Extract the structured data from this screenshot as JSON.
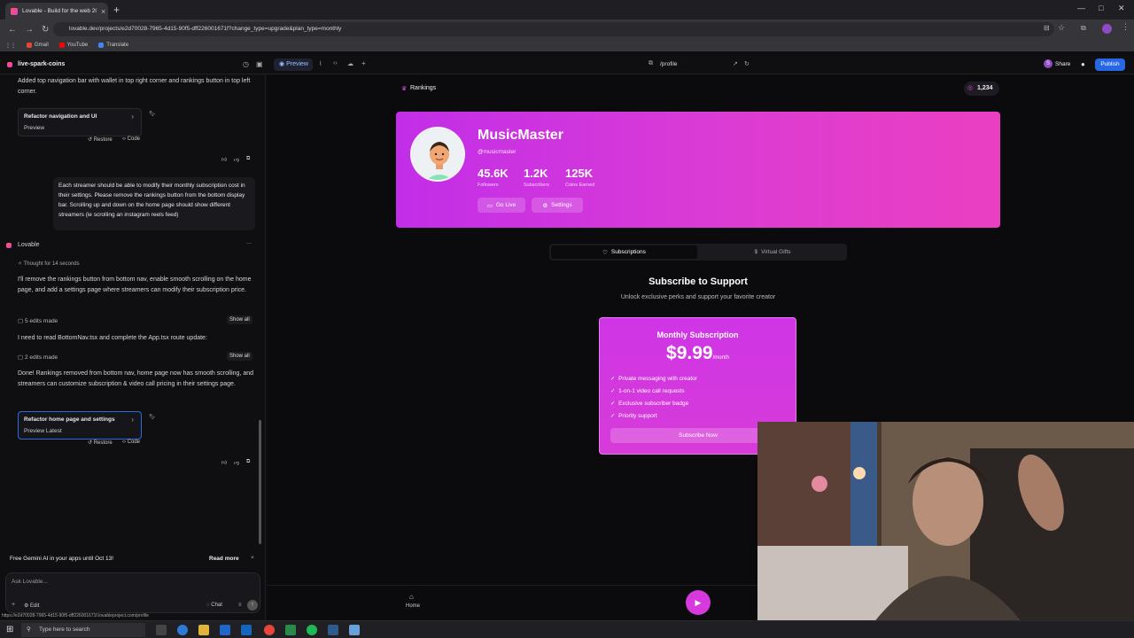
{
  "browser": {
    "tab_title": "Lovable - Build for the web 20x",
    "url": "lovable.dev/projects/e2d70028-7965-4d15-90f5-dff226001671f?change_type=upgrade&plan_type=monthly",
    "bookmarks": [
      "Gmail",
      "YouTube",
      "Translate"
    ]
  },
  "header": {
    "project_name": "live-spark-coins",
    "preview_label": "Preview",
    "route": "/profile",
    "share_label": "Share",
    "publish_label": "Publish",
    "avatar_initial": "S"
  },
  "chat": {
    "msg1": "Added top navigation bar with wallet in top right corner and rankings button in top left corner.",
    "card1_title": "Refactor navigation and UI",
    "card1_sub": "Preview",
    "restore_label": "Restore",
    "code_label": "Code",
    "user_msg": "Each streamer should be able to modify their monthly subscription cost in their settings. Please remove the rankings button from the bottom display bar. Scrolling up and down on the home page should show different streamers (ie scrolling an instagram reels feed)",
    "assistant_name": "Lovable",
    "thought": "Thought for 14 seconds",
    "reply1": "I'll remove the rankings button from bottom nav, enable smooth scrolling on the home page, and add a settings page where streamers can modify their subscription price.",
    "edits1": "5 edits made",
    "show_all": "Show all",
    "reply2": "I need to read BottomNav.tsx and complete the App.tsx route update:",
    "edits2": "2 edits made",
    "reply3": "Done! Rankings removed from bottom nav, home page now has smooth scrolling, and streamers can customize subscription & video call pricing in their settings page.",
    "card2_title": "Refactor home page and settings",
    "card2_sub": "Preview Latest",
    "notice": "Free Gemini AI in your apps until Oct 13!",
    "read_more": "Read more",
    "ask_placeholder": "Ask Lovable...",
    "edit_label": "Edit",
    "chat_label": "Chat",
    "status_url": "https://e2d70028-7965-4d15-90f5-dff226001671f.lovableproject.com/profile"
  },
  "app": {
    "rankings_label": "Rankings",
    "wallet": "1,234",
    "profile": {
      "name": "MusicMaster",
      "handle": "@musicmaster",
      "stats": [
        {
          "value": "45.6K",
          "label": "Followers"
        },
        {
          "value": "1.2K",
          "label": "Subscribers"
        },
        {
          "value": "125K",
          "label": "Coins Earned"
        }
      ],
      "go_live": "Go Live",
      "settings": "Settings"
    },
    "tabs": {
      "subscriptions": "Subscriptions",
      "gifts": "Virtual Gifts"
    },
    "subscribe_title": "Subscribe to Support",
    "subscribe_desc": "Unlock exclusive perks and support your favorite creator",
    "plan": {
      "title": "Monthly Subscription",
      "price": "$9.99",
      "period": "/month",
      "features": [
        "Private messaging with creator",
        "1-on-1 video call requests",
        "Exclusive subscriber badge",
        "Priority support"
      ],
      "cta": "Subscribe Now"
    },
    "nav_home": "Home"
  },
  "taskbar": {
    "search_placeholder": "Type here to search"
  }
}
